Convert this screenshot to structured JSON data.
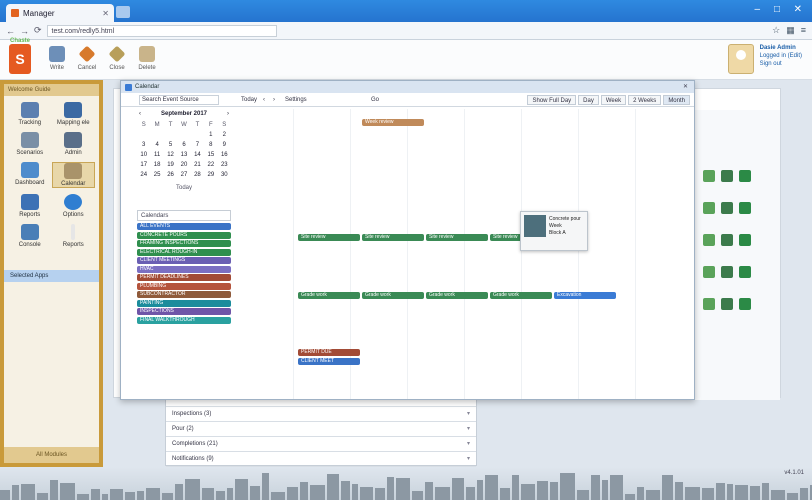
{
  "browser": {
    "tab_title": "Manager",
    "url": "test.com/redly5.html"
  },
  "header": {
    "logo_text": "S",
    "logo_caption": "Chaste",
    "buttons": [
      "Write",
      "Cancel",
      "Close",
      "Delete"
    ],
    "user_name": "Dasie Admin",
    "user_sub": "Logged in (Edit)",
    "sign_out": "Sign out"
  },
  "sidebar": {
    "heading": "Welcome Guide",
    "items": [
      "Tracking",
      "Mapping ele",
      "Scenarios",
      "Admin",
      "Dashboard",
      "Calendar",
      "Reports",
      "Options",
      "Console",
      "Reports"
    ],
    "selected_label": "Selected Apps",
    "footer": "All Modules"
  },
  "dialog": {
    "title": "Calendar",
    "toolbar": {
      "search_placeholder": "Search Event Source",
      "today": "Today",
      "settings": "Settings",
      "go": "Go",
      "views": [
        "Day",
        "Week",
        "2 Weeks",
        "Month"
      ],
      "active_view": "Month",
      "show_all": "Show Full Day"
    },
    "minical": {
      "month": "September 2017",
      "day_headers": [
        "S",
        "M",
        "T",
        "W",
        "T",
        "F",
        "S"
      ],
      "weeks": [
        [
          "",
          "",
          "",
          "",
          "",
          "1",
          "2"
        ],
        [
          "3",
          "4",
          "5",
          "6",
          "7",
          "8",
          "9"
        ],
        [
          "10",
          "11",
          "12",
          "13",
          "14",
          "15",
          "16"
        ],
        [
          "17",
          "18",
          "19",
          "20",
          "21",
          "22",
          "23"
        ],
        [
          "24",
          "25",
          "26",
          "27",
          "28",
          "29",
          "30"
        ]
      ],
      "today_label": "Today"
    },
    "filter_label": "Calendars",
    "calendar_tags": [
      {
        "label": "ALL EVENTS",
        "color": "#3a73c6"
      },
      {
        "label": "CONCRETE POURS",
        "color": "#2f8f4e"
      },
      {
        "label": "FRAMING INSPECTIONS",
        "color": "#2f8f4e"
      },
      {
        "label": "ELECTRICAL ROUGH-IN",
        "color": "#2f8f4e"
      },
      {
        "label": "CLIENT MEETINGS",
        "color": "#6a5fb3"
      },
      {
        "label": "HVAC",
        "color": "#7b6fc2"
      },
      {
        "label": "PERMIT DEADLINES",
        "color": "#a24b36"
      },
      {
        "label": "PLUMBING",
        "color": "#b5543d"
      },
      {
        "label": "SUBCONTRACTOR",
        "color": "#8f5a3a"
      },
      {
        "label": "PAINTING",
        "color": "#1b8c9c"
      },
      {
        "label": "INSPECTIONS",
        "color": "#6f55a8"
      },
      {
        "label": "FINAL WALKTHROUGH",
        "color": "#2aa1a0"
      }
    ],
    "events": [
      {
        "label": "Week review",
        "color": "#c08a5a",
        "row": 0,
        "col": 1,
        "span": 1
      },
      {
        "label": "Site review",
        "color": "#3a8a55",
        "row": 1,
        "col": 0,
        "span": 1
      },
      {
        "label": "Site review",
        "color": "#3a8a55",
        "row": 1,
        "col": 1,
        "span": 1
      },
      {
        "label": "Site review",
        "color": "#3a8a55",
        "row": 1,
        "col": 2,
        "span": 1
      },
      {
        "label": "Site review",
        "color": "#3a8a55",
        "row": 1,
        "col": 3,
        "span": 1
      },
      {
        "label": "Grade work",
        "color": "#3a8a55",
        "row": 2,
        "col": 0,
        "span": 1
      },
      {
        "label": "Grade work",
        "color": "#3a8a55",
        "row": 2,
        "col": 1,
        "span": 1
      },
      {
        "label": "Grade work",
        "color": "#3a8a55",
        "row": 2,
        "col": 2,
        "span": 1
      },
      {
        "label": "Grade work",
        "color": "#3a8a55",
        "row": 2,
        "col": 3,
        "span": 1
      },
      {
        "label": "Excavation",
        "color": "#3a7bd5",
        "row": 2,
        "col": 4,
        "span": 1
      },
      {
        "label": "PERMIT DUE",
        "color": "#a24b36",
        "row": 3,
        "col": 0,
        "span": 1
      },
      {
        "label": "CLIENT MEET",
        "color": "#3a73c6",
        "row": 3,
        "col": 0,
        "span": 1
      }
    ],
    "popup": {
      "lines": [
        "Concrete pour",
        "Week",
        "Block A"
      ]
    }
  },
  "accordion": {
    "items": [
      "Inspections (3)",
      "Pour (2)",
      "Completions (21)",
      "Notifications (9)"
    ]
  },
  "footer": {
    "version": "v4.1.01"
  }
}
